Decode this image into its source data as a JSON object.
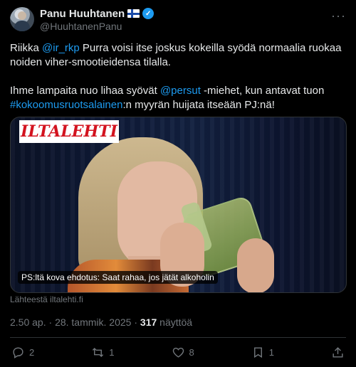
{
  "author": {
    "display_name": "Panu Huuhtanen",
    "handle": "@HuuhtanenPanu"
  },
  "more_label": "···",
  "tweet": {
    "line1_prefix": "Riikka ",
    "mention1": "@ir_rkp",
    "line1_suffix": " Purra voisi itse joskus kokeilla syödä normaalia ruokaa noiden viher-smootieidensa tilalla.",
    "line2_prefix": "Ihme lampaita nuo lihaa syövät ",
    "mention2": "@persut",
    "line2_mid": " -miehet, kun antavat tuon ",
    "hashtag": "#kokoomusruotsalainen",
    "line2_suffix": ":n myyrän huijata itseään PJ:nä!"
  },
  "media": {
    "logo_text": "ILTALEHTI",
    "caption": "PS:ltä kova ehdotus: Saat rahaa, jos jätät alkoholin"
  },
  "source": "Lähteestä iltalehti.fi",
  "meta": {
    "time": "2.50 ap.",
    "separator": " · ",
    "date": "28. tammik. 2025",
    "views_count": "317",
    "views_label": "näyttöä"
  },
  "actions": {
    "replies": "2",
    "reposts": "1",
    "likes": "8",
    "bookmarks": "1"
  },
  "colors": {
    "background": "#000000",
    "accent": "#1d9bf0",
    "muted": "#71767b",
    "logo_red": "#d3131f"
  }
}
